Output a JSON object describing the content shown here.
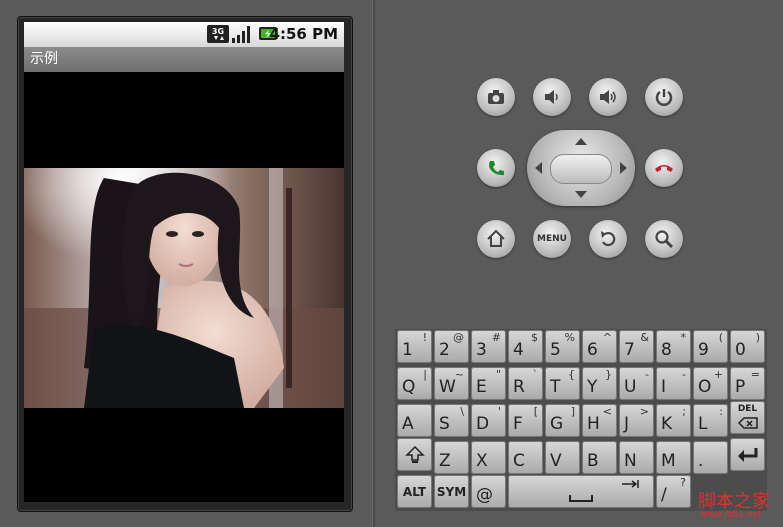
{
  "status_bar": {
    "network": "3G",
    "time": "4:56 PM"
  },
  "app": {
    "title": "示例"
  },
  "photo": {
    "description_icon": "photo-image"
  },
  "controls": {
    "menu_label": "MENU"
  },
  "keyboard": {
    "row1": [
      {
        "main": "1",
        "alt": "!"
      },
      {
        "main": "2",
        "alt": "@"
      },
      {
        "main": "3",
        "alt": "#"
      },
      {
        "main": "4",
        "alt": "$"
      },
      {
        "main": "5",
        "alt": "%"
      },
      {
        "main": "6",
        "alt": "^"
      },
      {
        "main": "7",
        "alt": "&"
      },
      {
        "main": "8",
        "alt": "*"
      },
      {
        "main": "9",
        "alt": "("
      },
      {
        "main": "0",
        "alt": ")"
      }
    ],
    "row2": [
      {
        "main": "Q",
        "alt": "|"
      },
      {
        "main": "W",
        "alt": "~"
      },
      {
        "main": "E",
        "alt": "\""
      },
      {
        "main": "R",
        "alt": "`"
      },
      {
        "main": "T",
        "alt": "{"
      },
      {
        "main": "Y",
        "alt": "}"
      },
      {
        "main": "U",
        "alt": "-"
      },
      {
        "main": "I",
        "alt": "-"
      },
      {
        "main": "O",
        "alt": "+"
      },
      {
        "main": "P",
        "alt": "="
      }
    ],
    "row3": [
      {
        "main": "A",
        "alt": ""
      },
      {
        "main": "S",
        "alt": "\\"
      },
      {
        "main": "D",
        "alt": "'"
      },
      {
        "main": "F",
        "alt": "["
      },
      {
        "main": "G",
        "alt": "]"
      },
      {
        "main": "H",
        "alt": "<"
      },
      {
        "main": "J",
        "alt": ">"
      },
      {
        "main": "K",
        "alt": ";"
      },
      {
        "main": "L",
        "alt": ":"
      }
    ],
    "del_label": "DEL",
    "row4": [
      {
        "main": "Z",
        "alt": ""
      },
      {
        "main": "X",
        "alt": ""
      },
      {
        "main": "C",
        "alt": ""
      },
      {
        "main": "V",
        "alt": ""
      },
      {
        "main": "B",
        "alt": ""
      },
      {
        "main": "N",
        "alt": ""
      },
      {
        "main": "M",
        "alt": ""
      },
      {
        "main": ".",
        "alt": ""
      }
    ],
    "alt_label": "ALT",
    "sym_label": "SYM",
    "at_label": "@",
    "slash_label": "/",
    "slash_alt": "?"
  },
  "watermark": {
    "text": "脚本之家",
    "url": "www.jb51.net"
  },
  "colors": {
    "call_green": "#1a8a2a",
    "end_red": "#c8202a",
    "watermark": "#e03030"
  }
}
